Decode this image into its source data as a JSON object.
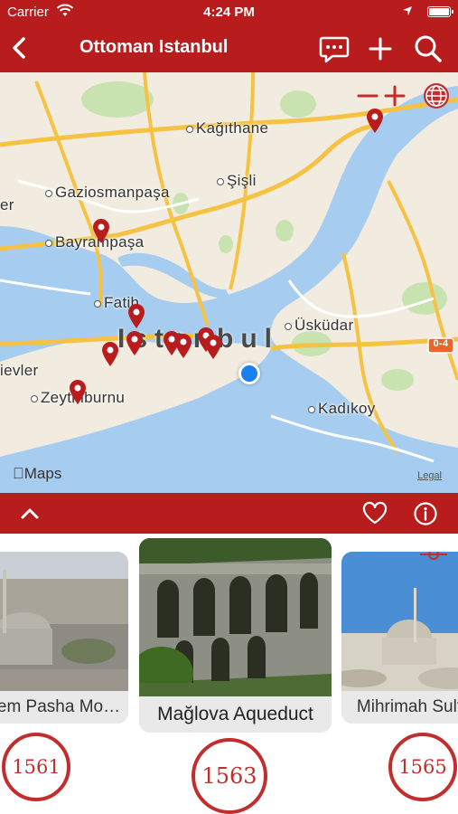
{
  "status": {
    "carrier": "Carrier",
    "time": "4:24 PM"
  },
  "navbar": {
    "title": "Ottoman Istanbul",
    "icons": [
      "back-chevron-icon",
      "chat-icon",
      "plus-icon",
      "search-icon"
    ]
  },
  "map": {
    "places": [
      "Kağıthane",
      "Şişli",
      "Gaziosmanpaşa",
      "Bayrampaşa",
      "Fatih",
      "Üsküdar",
      "Kadıkoy",
      "Zeytinburnu",
      "ievler",
      "er"
    ],
    "city_label": "Istanbul",
    "road_badge": "0-4",
    "zoom_out": "−",
    "zoom_in": "+",
    "maps_brand": "Maps",
    "legal": "Legal"
  },
  "toolbar": {
    "icons": [
      "chevron-up-icon",
      "heart-icon",
      "info-icon"
    ]
  },
  "cards": [
    {
      "caption": "em Pasha Mo…"
    },
    {
      "caption": "Mağlova Aqueduct"
    },
    {
      "caption": "Mihrimah Sult"
    }
  ],
  "years": [
    "1561",
    "1563",
    "1565"
  ],
  "colors": {
    "brand_red": "#b81c1c",
    "water": "#a6cdf0",
    "land": "#f1ecdf",
    "user_dot": "#1a7ff0"
  }
}
